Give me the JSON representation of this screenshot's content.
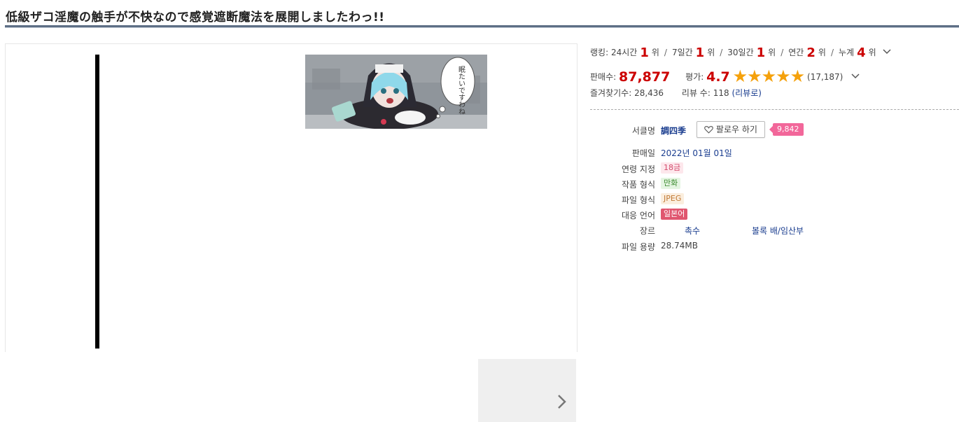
{
  "title": "低級ザコ淫魔の触手が不快なので感覚遮断魔法を展開しましたわっ!!",
  "thumbnail": {
    "speech_text": "眠たいですわね"
  },
  "ranking": {
    "label": "랭킹:",
    "items": [
      {
        "period": "24시간",
        "rank": "1",
        "suffix": "위"
      },
      {
        "period": "7일간",
        "rank": "1",
        "suffix": "위"
      },
      {
        "period": "30일간",
        "rank": "1",
        "suffix": "위"
      },
      {
        "period": "연간",
        "rank": "2",
        "suffix": "위"
      },
      {
        "period": "누계",
        "rank": "4",
        "suffix": "위"
      }
    ]
  },
  "sales": {
    "label": "판매수:",
    "value": "87,877"
  },
  "rating": {
    "label": "평가:",
    "value": "4.7",
    "stars": 4.7,
    "count": "(17,187)"
  },
  "favorites": {
    "label": "즐겨찾기수:",
    "value": "28,436"
  },
  "reviews": {
    "label": "리뷰 수:",
    "value": "118",
    "link": "(리뷰로)"
  },
  "circle": {
    "label": "서클명",
    "name": "調四季",
    "follow_label": "팔로우 하기",
    "follower_count": "9,842"
  },
  "details": {
    "release_label": "판매일",
    "release_value": "2022년 01월 01일",
    "age_label": "연령 지정",
    "age_value": "18금",
    "format_label": "작품 형식",
    "format_value": "만화",
    "file_label": "파일 형식",
    "file_value": "JPEG",
    "lang_label": "대응 언어",
    "lang_value": "일본어",
    "genre_label": "장르",
    "genre_1": "촉수",
    "genre_2": "볼록 배/임산부",
    "size_label": "파일 용량",
    "size_value": "28.74MB"
  },
  "colors": {
    "rank_red": "#cc0000",
    "star": "#f5a10b",
    "follow_badge": "#f2679a",
    "title_rule": "#5d6e85"
  }
}
